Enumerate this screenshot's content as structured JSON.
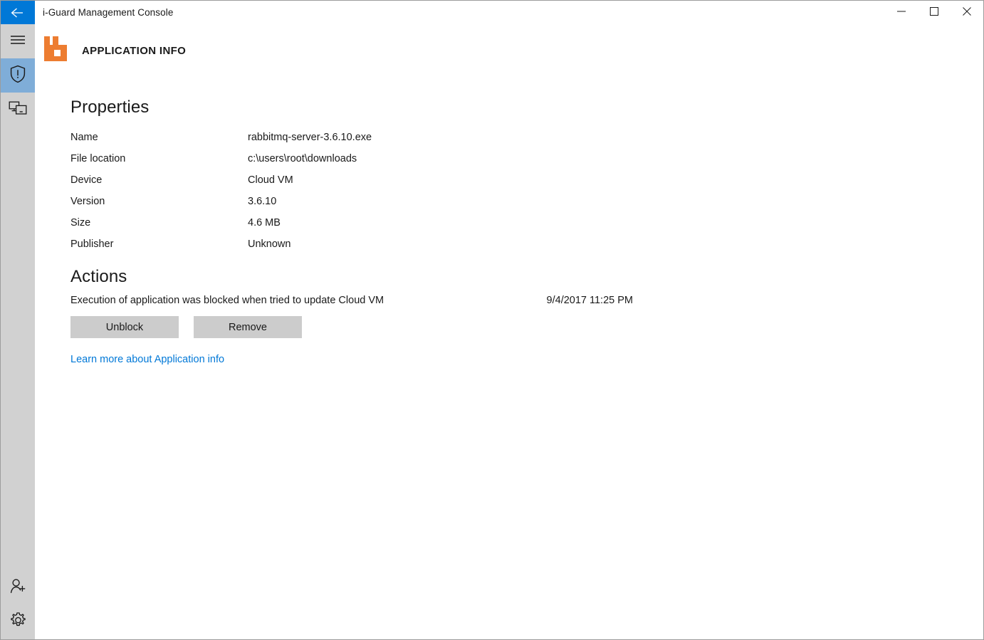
{
  "window": {
    "title": "i-Guard Management Console",
    "back_icon": "back-arrow-icon",
    "controls": {
      "minimize": "minimize-icon",
      "maximize": "maximize-icon",
      "close": "close-icon"
    }
  },
  "sidebar": {
    "items": [
      {
        "icon": "hamburger-menu-icon",
        "label": "Menu",
        "selected": false
      },
      {
        "icon": "shield-alert-icon",
        "label": "Application info",
        "selected": true
      },
      {
        "icon": "devices-icon",
        "label": "Devices",
        "selected": false
      }
    ],
    "bottom_items": [
      {
        "icon": "add-user-icon",
        "label": "Add user",
        "selected": false
      },
      {
        "icon": "settings-gear-icon",
        "label": "Settings",
        "selected": false
      }
    ]
  },
  "page": {
    "logo_icon": "i-guard-logo-icon",
    "logo_color": "#ED7D31",
    "title": "APPLICATION INFO"
  },
  "properties": {
    "heading": "Properties",
    "rows": [
      {
        "label": "Name",
        "value": "rabbitmq-server-3.6.10.exe"
      },
      {
        "label": "File location",
        "value": "c:\\users\\root\\downloads"
      },
      {
        "label": "Device",
        "value": "Cloud VM"
      },
      {
        "label": "Version",
        "value": "3.6.10"
      },
      {
        "label": "Size",
        "value": "4.6 MB"
      },
      {
        "label": "Publisher",
        "value": "Unknown"
      }
    ]
  },
  "actions": {
    "heading": "Actions",
    "activity": {
      "text": "Execution of application was blocked when tried to update Cloud VM",
      "timestamp": "9/4/2017 11:25 PM"
    },
    "buttons": [
      {
        "label": "Unblock",
        "name": "unblock-button"
      },
      {
        "label": "Remove",
        "name": "remove-button"
      }
    ],
    "learn_more": "Learn more about Application info",
    "link_color": "#0078D7"
  },
  "theme": {
    "accent": "#0078D7",
    "sidebar_bg": "#D1D1D1",
    "sidebar_selected": "#7FADD8",
    "button_bg": "#CCCCCC"
  }
}
